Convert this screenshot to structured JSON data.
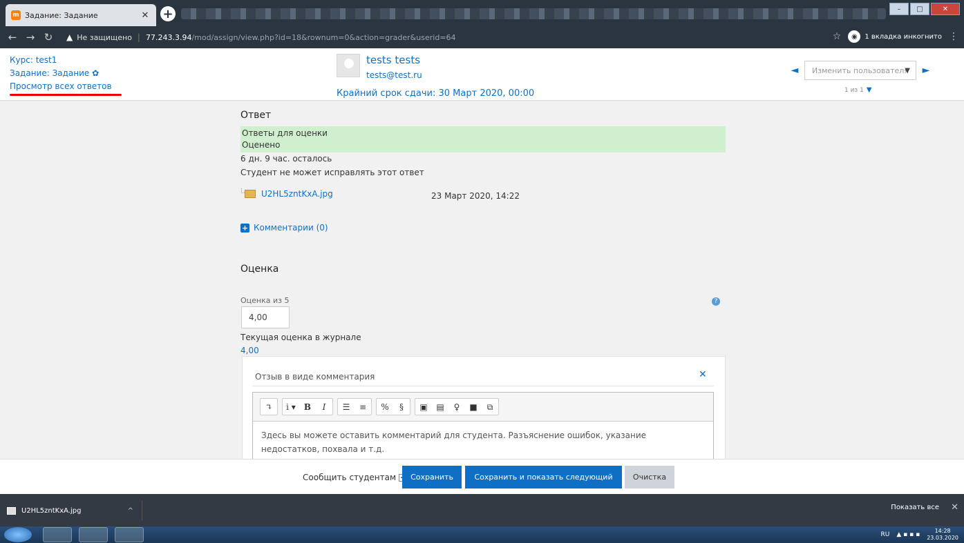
{
  "browser": {
    "tab_title": "Задание: Задание",
    "tab_favicon": "m",
    "url_warning": "Не защищено",
    "url_host": "77.243.3.94",
    "url_path": "/mod/assign/view.php?id=18&rownum=0&action=grader&userid=64",
    "incognito_label": "1 вкладка инкогнито"
  },
  "header": {
    "course_link": "Курс: test1",
    "assignment_link": "Задание: Задание",
    "view_all_link": "Просмотр всех ответов",
    "user_name": "tests tests",
    "user_email": "tests@test.ru",
    "deadline": "Крайний срок сдачи: 30 Март 2020, 00:00",
    "change_user_placeholder": "Изменить пользователя",
    "user_count": "1 из 1"
  },
  "submission": {
    "heading": "Ответ",
    "status_line1": "Ответы для оценки",
    "status_line2": "Оценено",
    "time_left": "6 дн. 9 час. осталось",
    "cannot_edit": "Студент не может исправлять этот ответ",
    "file_name": "U2HL5zntKxA.jpg",
    "file_date": "23 Март 2020, 14:22",
    "comments": "Комментарии (0)"
  },
  "grade": {
    "heading": "Оценка",
    "label": "Оценка из 5",
    "value": "4,00",
    "current_label": "Текущая оценка в журнале",
    "current_value": "4,00"
  },
  "feedback": {
    "title": "Отзыв в виде комментария",
    "editor_text": "Здесь вы можете оставить комментарий для студента. Разъяснение ошибок, указание недостатков, похвала и т.д."
  },
  "footer": {
    "notify_label": "Сообщить студентам",
    "save": "Сохранить",
    "save_next": "Сохранить и показать следующий",
    "reset": "Очистка"
  },
  "downloads": {
    "file": "U2HL5zntKxA.jpg",
    "show_all": "Показать все"
  },
  "taskbar": {
    "lang": "RU",
    "time": "14:28",
    "date": "23.03.2020"
  },
  "colors": {
    "accent": "#0f6fc5",
    "status_green": "#cfefcf",
    "underline": "#ee0000"
  }
}
